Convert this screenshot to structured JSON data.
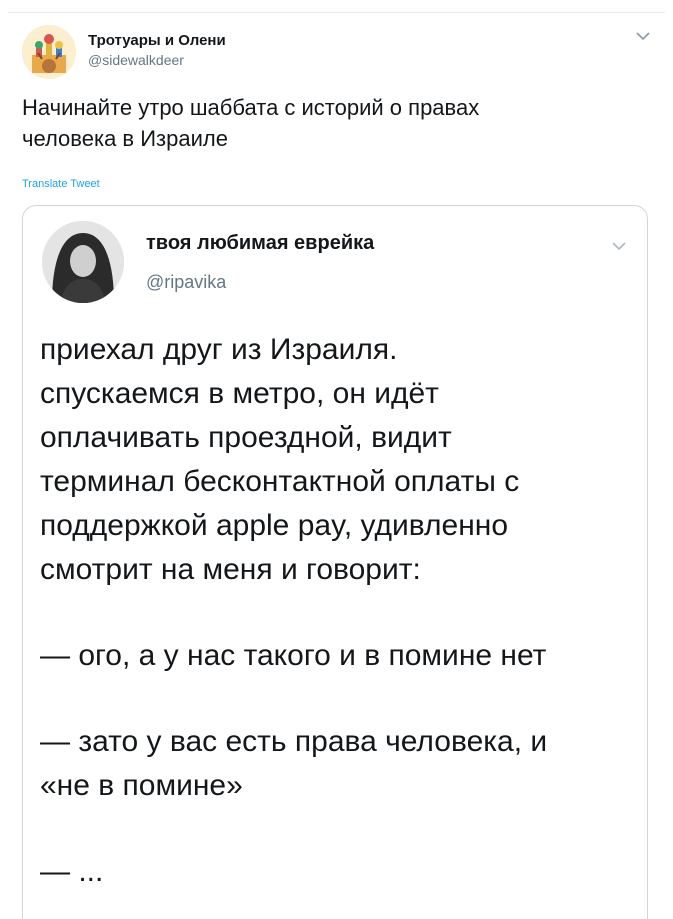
{
  "tweet": {
    "author_name": "Тротуары и Олени",
    "author_handle": "@sidewalkdeer",
    "text": "Начинайте утро шаббата с историй о правах\nчеловека в Израиле",
    "translate_label": "Translate Tweet",
    "avatar_icon": "cathedral-deer-illustration",
    "menu_icon": "chevron-down-icon"
  },
  "quoted_tweet": {
    "author_name": "твоя любимая еврейка",
    "author_handle": "@ripavika",
    "avatar_icon": "profile-photo",
    "menu_icon": "chevron-down-icon",
    "paragraphs": [
      "приехал друг из Израиля.\nспускаемся в метро, он идёт\nоплачивать проездной, видит\nтерминал бесконтактной оплаты с\nподдержкой apple pay, удивленно\nсмотрит на меня и говорит:",
      "— ого, а у нас такого и в помине нет",
      "— зато у вас есть права человека, и\n«не в помине»",
      "— ..."
    ]
  },
  "colors": {
    "text_primary": "#14171a",
    "text_secondary": "#657786",
    "link": "#1da1f2",
    "border": "#ccd6dd"
  }
}
